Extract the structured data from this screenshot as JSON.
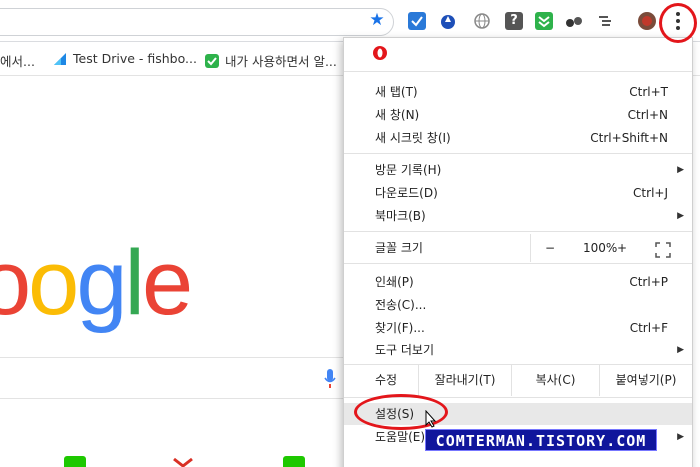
{
  "toolbar": {
    "bookmark_star_icon": "star-icon",
    "extensions": [
      "todo-check-icon",
      "blue-drop-icon",
      "globe-icon",
      "help-icon",
      "download-icon",
      "binoculars-icon",
      "tree-list-icon",
      "avatar-icon"
    ],
    "menu_icon": "more-vert-icon"
  },
  "bookmarks": [
    {
      "label": "에서...",
      "icon": "page-icon"
    },
    {
      "label": "Test Drive - fishbo...",
      "icon": "test-drive-icon"
    },
    {
      "label": "내가 사용하면서 알...",
      "icon": "green-note-icon"
    }
  ],
  "page": {
    "logo_letters": [
      "o",
      "o",
      "g",
      "l",
      "e"
    ],
    "logo_colors": [
      "#ea4335",
      "#fbbc05",
      "#4285f4",
      "#34a853",
      "#ea4335"
    ]
  },
  "menu": {
    "profile_icon": "opera-icon",
    "new_tab": "새 탭(T)",
    "new_tab_sc": "Ctrl+T",
    "new_window": "새 창(N)",
    "new_window_sc": "Ctrl+N",
    "incognito": "새 시크릿 창(I)",
    "incognito_sc": "Ctrl+Shift+N",
    "history": "방문 기록(H)",
    "downloads": "다운로드(D)",
    "downloads_sc": "Ctrl+J",
    "bookmarks": "북마크(B)",
    "zoom_label": "글꼴 크기",
    "zoom_minus": "−",
    "zoom_value": "100%",
    "zoom_plus": "+",
    "print": "인쇄(P)",
    "print_sc": "Ctrl+P",
    "cast": "전송(C)...",
    "find": "찾기(F)...",
    "find_sc": "Ctrl+F",
    "more_tools": "도구 더보기",
    "edit_label": "수정",
    "cut": "잘라내기(T)",
    "copy": "복사(C)",
    "paste": "붙여넣기(P)",
    "settings": "설정(S)",
    "help": "도움말(E)"
  },
  "watermark": "COMTERMAN.TISTORY.COM",
  "colors": {
    "highlight_ring": "#e3161b",
    "watermark_bg": "#10169c",
    "accent": "#1a73e8"
  }
}
